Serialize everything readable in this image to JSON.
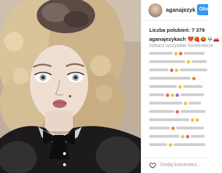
{
  "header": {
    "username": "aganajezyk",
    "follow_label": "Obs"
  },
  "post": {
    "likes_label": "Liczba polubień: 7 379",
    "caption_user": "aganajezykach",
    "caption_emoji": " ❤️🍓🎃💀🚗",
    "more_comments": "zobacz wszystkie komentarze"
  },
  "footer": {
    "add_comment_placeholder": "Dodaj komentarz..."
  },
  "colors": {
    "accent": "#3897f0",
    "text": "#262626",
    "muted": "#999999"
  },
  "icons": [
    "heart-icon",
    "avatar"
  ]
}
